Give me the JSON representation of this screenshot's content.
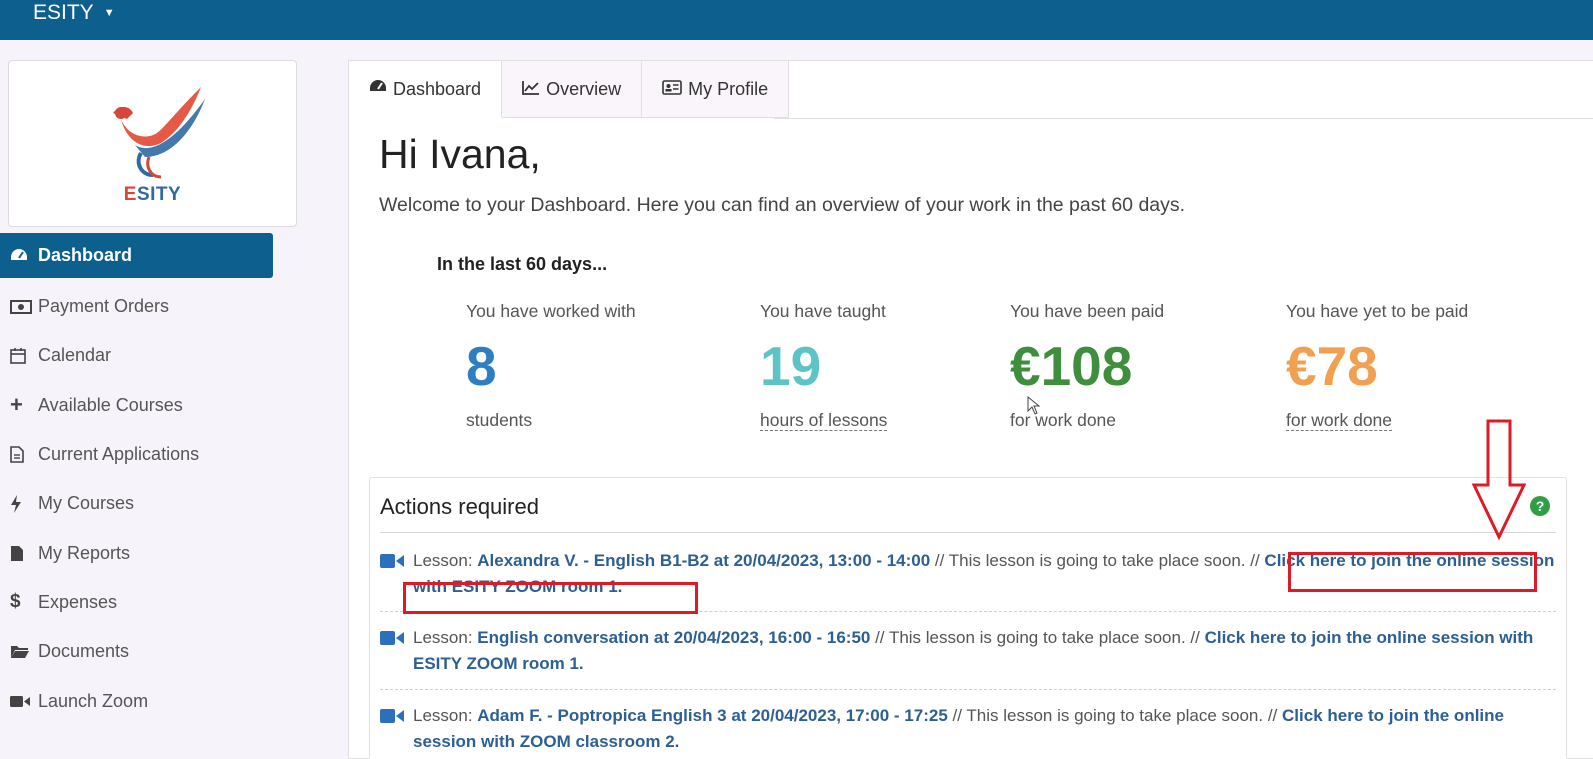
{
  "app": {
    "name": "ESITY"
  },
  "logo": {
    "text_e": "E",
    "text_rest": "SITY"
  },
  "sidebar": {
    "items": [
      {
        "label": "Dashboard",
        "icon": "dashboard-icon",
        "active": true
      },
      {
        "label": "Payment Orders",
        "icon": "money-icon"
      },
      {
        "label": "Calendar",
        "icon": "calendar-icon"
      },
      {
        "label": "Available Courses",
        "icon": "plus-icon"
      },
      {
        "label": "Current Applications",
        "icon": "document-icon"
      },
      {
        "label": "My Courses",
        "icon": "bolt-icon"
      },
      {
        "label": "My Reports",
        "icon": "file-icon"
      },
      {
        "label": "Expenses",
        "icon": "dollar-icon"
      },
      {
        "label": "Documents",
        "icon": "folder-icon"
      },
      {
        "label": "Launch Zoom",
        "icon": "video-icon"
      }
    ]
  },
  "tabs": [
    {
      "label": "Dashboard",
      "icon": "dashboard-icon"
    },
    {
      "label": "Overview",
      "icon": "chart-icon"
    },
    {
      "label": "My Profile",
      "icon": "id-card-icon"
    }
  ],
  "main": {
    "greeting": "Hi Ivana,",
    "welcome": "Welcome to your Dashboard. Here you can find an overview of your work in the past 60 days.",
    "stats_heading": "In the last 60 days...",
    "stats": [
      {
        "label": "You have worked with",
        "value": "8",
        "sub": "students",
        "color": "#2f7ec1"
      },
      {
        "label": "You have taught",
        "value": "19",
        "sub": "hours of lessons",
        "color": "#5cc4c4"
      },
      {
        "label": "You have been paid",
        "value": "€108",
        "sub": "for work done",
        "color": "#3e8e3e"
      },
      {
        "label": "You have yet to be paid",
        "value": "€78",
        "sub": "for work done",
        "color": "#f0a050"
      }
    ]
  },
  "actions": {
    "title": "Actions required",
    "lessons": [
      {
        "prefix": "Lesson: ",
        "name": "Alexandra V. - English B1-B2 at 20/04/2023, 13:00 - 14:00",
        "mid": " // This lesson is going to take place soon. // ",
        "link": "Click here to join the online session with ESITY ZOOM room 1."
      },
      {
        "prefix": "Lesson: ",
        "name": "English conversation at 20/04/2023, 16:00 - 16:50",
        "mid": " // This lesson is going to take place soon. // ",
        "link": "Click here to join the online session with ESITY ZOOM room 1."
      },
      {
        "prefix": "Lesson: ",
        "name": "Adam F. - Poptropica English 3 at 20/04/2023, 17:00 - 17:25",
        "mid": " // This lesson is going to take place soon. // ",
        "link": "Click here to join the online session with ZOOM classroom 2."
      }
    ]
  },
  "colors": {
    "primary": "#0d5f8e",
    "link": "#2c5f93",
    "annotation": "#dd1b27"
  }
}
